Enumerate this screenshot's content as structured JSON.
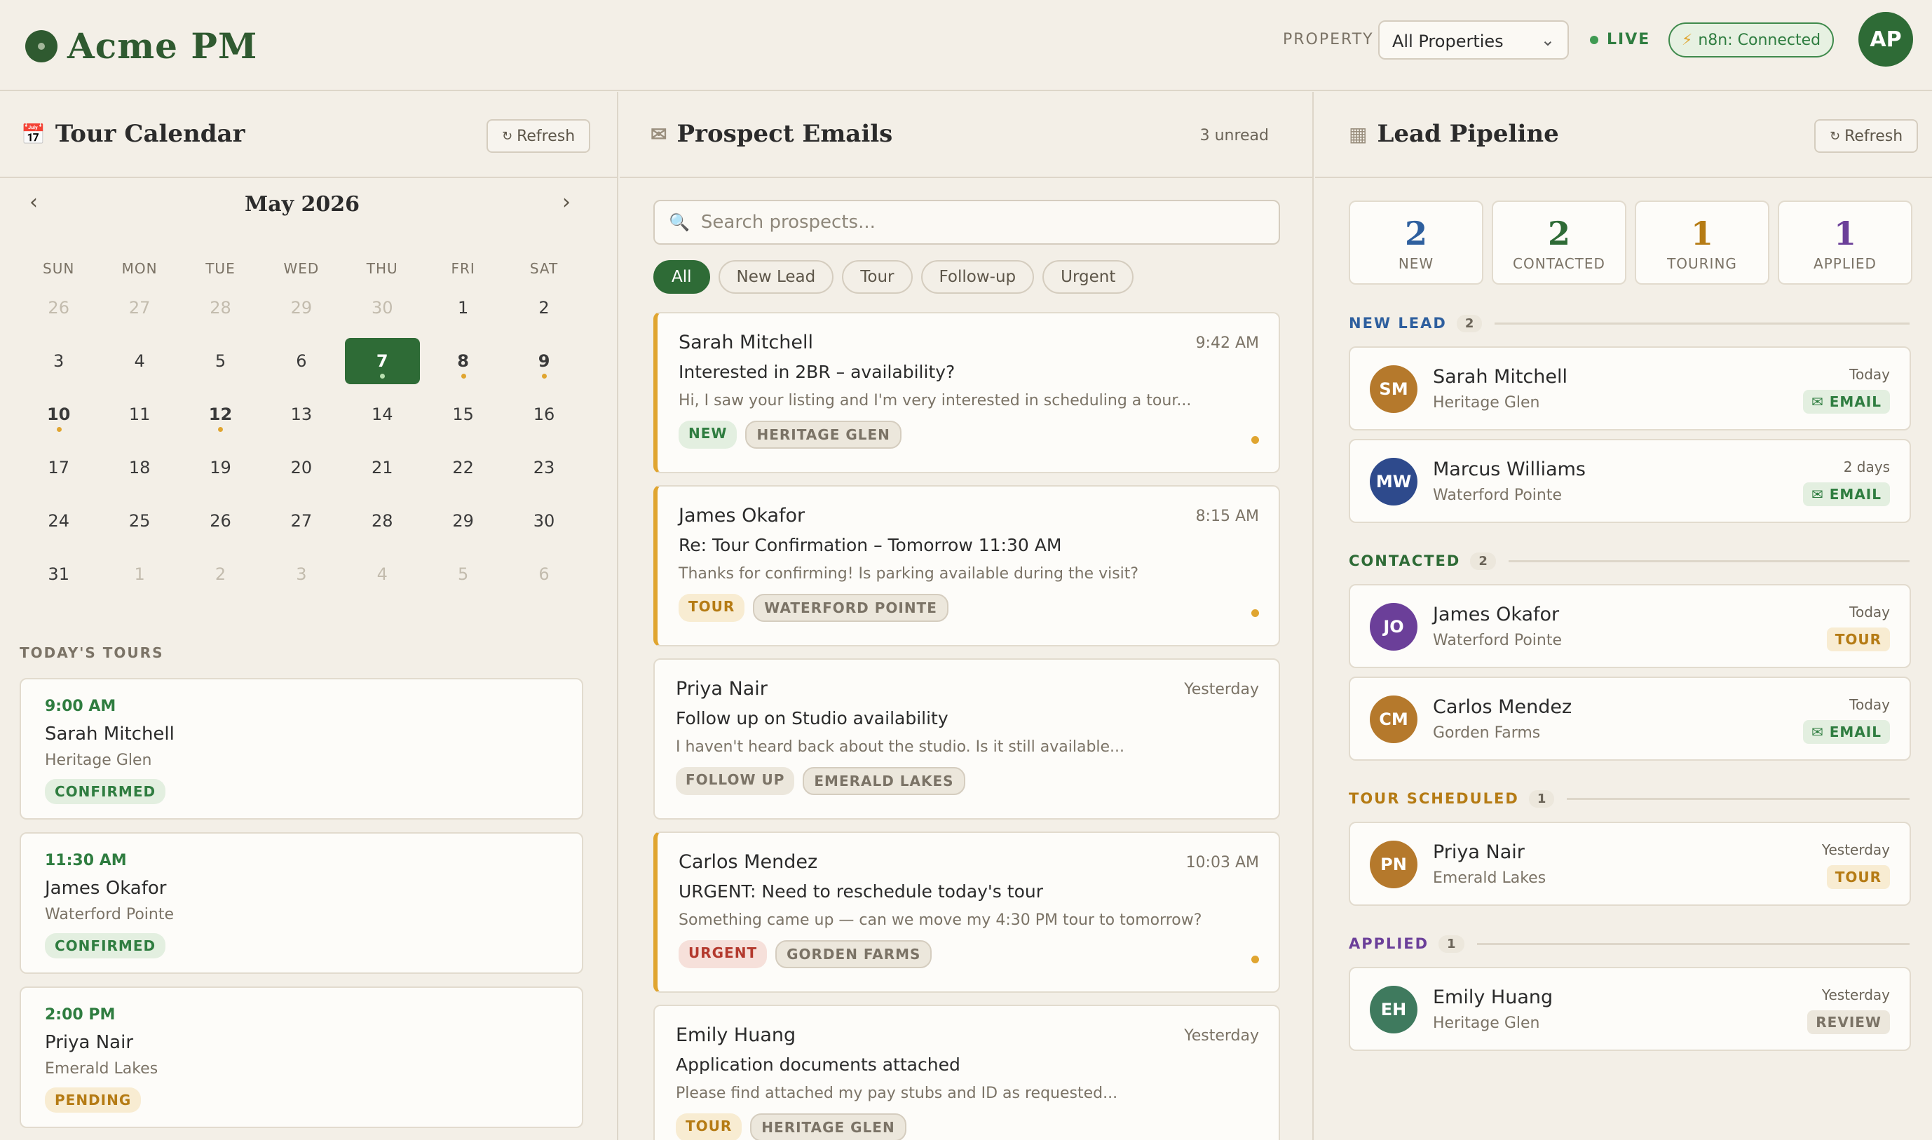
{
  "header": {
    "app_name": "Acme PM",
    "property_label": "PROPERTY",
    "property_value": "All Properties",
    "live_label": "LIVE",
    "n8n_label": "n8n: Connected",
    "user_initials": "AP"
  },
  "calendar": {
    "title": "Tour Calendar",
    "refresh_label": "Refresh",
    "month": "May 2026",
    "weekdays": [
      "SUN",
      "MON",
      "TUE",
      "WED",
      "THU",
      "FRI",
      "SAT"
    ],
    "weeks": [
      [
        {
          "d": "26",
          "m": true
        },
        {
          "d": "27",
          "m": true
        },
        {
          "d": "28",
          "m": true
        },
        {
          "d": "29",
          "m": true
        },
        {
          "d": "30",
          "m": true
        },
        {
          "d": "1"
        },
        {
          "d": "2"
        }
      ],
      [
        {
          "d": "3"
        },
        {
          "d": "4"
        },
        {
          "d": "5"
        },
        {
          "d": "6"
        },
        {
          "d": "7",
          "today": true,
          "dot": true
        },
        {
          "d": "8",
          "dot": true
        },
        {
          "d": "9",
          "dot": true
        }
      ],
      [
        {
          "d": "10",
          "dot": true
        },
        {
          "d": "11"
        },
        {
          "d": "12",
          "dot": true
        },
        {
          "d": "13"
        },
        {
          "d": "14"
        },
        {
          "d": "15"
        },
        {
          "d": "16"
        }
      ],
      [
        {
          "d": "17"
        },
        {
          "d": "18"
        },
        {
          "d": "19"
        },
        {
          "d": "20"
        },
        {
          "d": "21"
        },
        {
          "d": "22"
        },
        {
          "d": "23"
        }
      ],
      [
        {
          "d": "24"
        },
        {
          "d": "25"
        },
        {
          "d": "26"
        },
        {
          "d": "27"
        },
        {
          "d": "28"
        },
        {
          "d": "29"
        },
        {
          "d": "30"
        }
      ],
      [
        {
          "d": "31"
        },
        {
          "d": "1",
          "m": true
        },
        {
          "d": "2",
          "m": true
        },
        {
          "d": "3",
          "m": true
        },
        {
          "d": "4",
          "m": true
        },
        {
          "d": "5",
          "m": true
        },
        {
          "d": "6",
          "m": true
        }
      ]
    ],
    "todays_tours_label": "TODAY'S TOURS",
    "tours": [
      {
        "time": "9:00 AM",
        "name": "Sarah Mitchell",
        "property": "Heritage Glen",
        "status": "CONFIRMED"
      },
      {
        "time": "11:30 AM",
        "name": "James Okafor",
        "property": "Waterford Pointe",
        "status": "CONFIRMED"
      },
      {
        "time": "2:00 PM",
        "name": "Priya Nair",
        "property": "Emerald Lakes",
        "status": "PENDING"
      }
    ]
  },
  "emails": {
    "title": "Prospect Emails",
    "unread_label": "3 unread",
    "search_placeholder": "Search prospects...",
    "filters": [
      "All",
      "New Lead",
      "Tour",
      "Follow-up",
      "Urgent"
    ],
    "items": [
      {
        "name": "Sarah Mitchell",
        "time": "9:42 AM",
        "subject": "Interested in 2BR – availability?",
        "preview": "Hi, I saw your listing and I'm very interested in scheduling a tour...",
        "tag": "NEW",
        "property": "HERITAGE GLEN"
      },
      {
        "name": "James Okafor",
        "time": "8:15 AM",
        "subject": "Re: Tour Confirmation – Tomorrow 11:30 AM",
        "preview": "Thanks for confirming! Is parking available during the visit?",
        "tag": "TOUR",
        "property": "WATERFORD POINTE"
      },
      {
        "name": "Priya Nair",
        "time": "Yesterday",
        "subject": "Follow up on Studio availability",
        "preview": "I haven't heard back about the studio. Is it still available...",
        "tag": "FOLLOW UP",
        "property": "EMERALD LAKES"
      },
      {
        "name": "Carlos Mendez",
        "time": "10:03 AM",
        "subject": "URGENT: Need to reschedule today's tour",
        "preview": "Something came up — can we move my 4:30 PM tour to tomorrow?",
        "tag": "URGENT",
        "property": "GORDEN FARMS"
      },
      {
        "name": "Emily Huang",
        "time": "Yesterday",
        "subject": "Application documents attached",
        "preview": "Please find attached my pay stubs and ID as requested...",
        "tag": "TOUR",
        "property": "HERITAGE GLEN"
      }
    ]
  },
  "leads": {
    "title": "Lead Pipeline",
    "refresh_label": "Refresh",
    "stats": [
      {
        "num": "2",
        "label": "NEW",
        "color": "#2e5f9e"
      },
      {
        "num": "2",
        "label": "CONTACTED",
        "color": "#2e6b36"
      },
      {
        "num": "1",
        "label": "TOURING",
        "color": "#b57b14"
      },
      {
        "num": "1",
        "label": "APPLIED",
        "color": "#6b3f99"
      }
    ],
    "sections": [
      {
        "label": "NEW LEAD",
        "count": "2",
        "color": "#2e5f9e"
      },
      {
        "label": "CONTACTED",
        "count": "2",
        "color": "#2e6b36"
      },
      {
        "label": "TOUR SCHEDULED",
        "count": "1",
        "color": "#b57b14"
      },
      {
        "label": "APPLIED",
        "count": "1",
        "color": "#6b3f99"
      }
    ],
    "cards": [
      {
        "initials": "SM",
        "name": "Sarah Mitchell",
        "property": "Heritage Glen",
        "when": "Today",
        "badge": "✉ EMAIL",
        "avatar_color": "#b5792c"
      },
      {
        "initials": "MW",
        "name": "Marcus Williams",
        "property": "Waterford Pointe",
        "when": "2 days",
        "badge": "✉ EMAIL",
        "avatar_color": "#2e4a8c"
      },
      {
        "initials": "JO",
        "name": "James Okafor",
        "property": "Waterford Pointe",
        "when": "Today",
        "badge": "TOUR",
        "avatar_color": "#6b3f99"
      },
      {
        "initials": "CM",
        "name": "Carlos Mendez",
        "property": "Gorden Farms",
        "when": "Today",
        "badge": "✉ EMAIL",
        "avatar_color": "#b5792c"
      },
      {
        "initials": "PN",
        "name": "Priya Nair",
        "property": "Emerald Lakes",
        "when": "Yesterday",
        "badge": "TOUR",
        "avatar_color": "#b5792c"
      },
      {
        "initials": "EH",
        "name": "Emily Huang",
        "property": "Heritage Glen",
        "when": "Yesterday",
        "badge": "REVIEW",
        "avatar_color": "#3f7a5e"
      }
    ]
  }
}
